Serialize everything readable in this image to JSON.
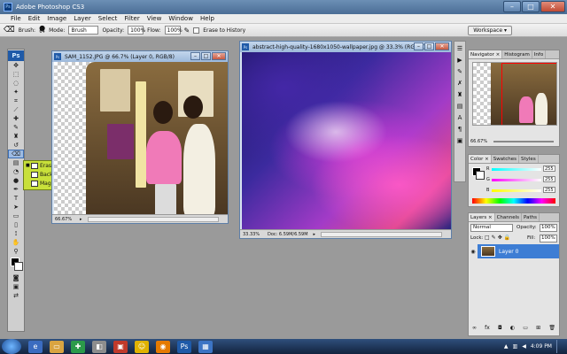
{
  "app": {
    "title": "Adobe Photoshop CS3",
    "window_buttons": [
      "–",
      "□",
      "✕"
    ]
  },
  "menu": [
    "File",
    "Edit",
    "Image",
    "Layer",
    "Select",
    "Filter",
    "View",
    "Window",
    "Help"
  ],
  "options": {
    "brush_label": "Brush:",
    "brush_size": "64",
    "mode_label": "Mode:",
    "mode_value": "Brush",
    "opacity_label": "Opacity:",
    "opacity_value": "100%",
    "flow_label": "Flow:",
    "flow_value": "100%",
    "erase_history": "Erase to History",
    "workspace": "Workspace ▾"
  },
  "flyout": [
    {
      "label": "Eraser Tool",
      "key": "E",
      "selected": true
    },
    {
      "label": "Background Eraser Tool",
      "key": "E",
      "selected": false
    },
    {
      "label": "Magic Eraser Tool",
      "key": "E",
      "selected": false
    }
  ],
  "doc1": {
    "title": "SAM_1152.JPG @ 66.7% (Layer 0, RGB/8)",
    "zoom": "66.67%"
  },
  "doc2": {
    "title": "abstract-high-quality-1680x1050-wallpaper.jpg @ 33.3% (RGB/8)",
    "zoom": "33.33%",
    "docinfo": "Doc: 6.59M/6.59M"
  },
  "navigator": {
    "tabs": [
      "Navigator ×",
      "Histogram",
      "Info"
    ],
    "zoom": "66.67%"
  },
  "color": {
    "tabs": [
      "Color ×",
      "Swatches",
      "Styles"
    ],
    "channels": [
      {
        "label": "R",
        "value": "255"
      },
      {
        "label": "G",
        "value": "255"
      },
      {
        "label": "B",
        "value": "255"
      }
    ]
  },
  "layers": {
    "tabs": [
      "Layers ×",
      "Channels",
      "Paths"
    ],
    "blend_mode": "Normal",
    "opacity_label": "Opacity:",
    "opacity_value": "100%",
    "lock_label": "Lock:",
    "fill_label": "Fill:",
    "fill_value": "100%",
    "layer_name": "Layer 0"
  },
  "taskbar": {
    "time": "4:09 PM"
  }
}
